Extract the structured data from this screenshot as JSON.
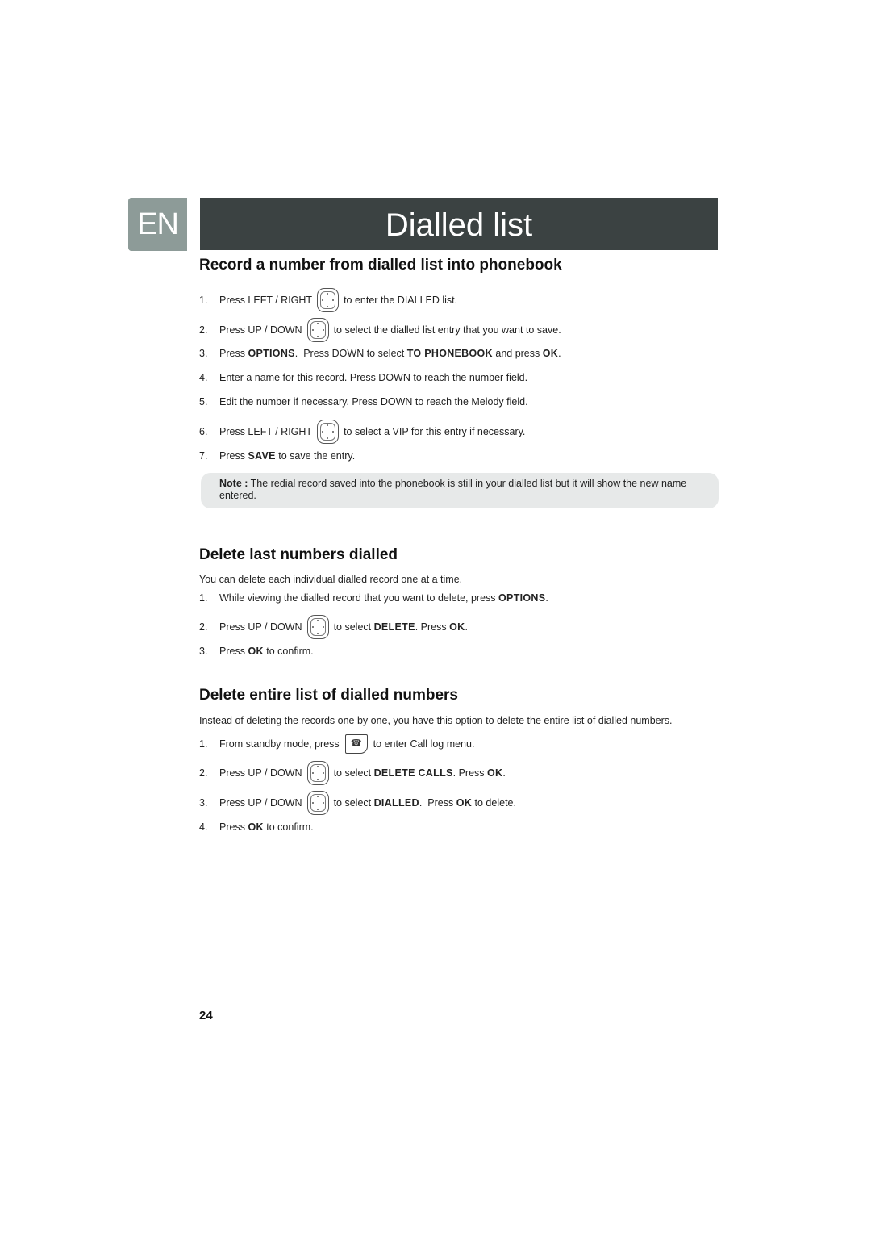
{
  "header": {
    "language": "EN",
    "title": "Dialled list"
  },
  "section1": {
    "heading": "Record a number from dialled list into phonebook",
    "steps": [
      {
        "num": "1.",
        "pre": "Press LEFT / RIGHT",
        "icon": "nav-key-icon",
        "post": "to enter the DIALLED list."
      },
      {
        "num": "2.",
        "pre": "Press UP / DOWN",
        "icon": "nav-key-icon",
        "post": "to select the dialled list entry that you want to save."
      },
      {
        "num": "3.",
        "parts": [
          "Press ",
          "OPTIONS",
          ".  Press DOWN to select ",
          "TO PHONEBOOK",
          " and press ",
          "OK",
          "."
        ]
      },
      {
        "num": "4.",
        "text": "Enter a name for this record. Press DOWN to reach the number field."
      },
      {
        "num": "5.",
        "text": "Edit the number if necessary. Press DOWN to reach the Melody field."
      },
      {
        "num": "6.",
        "pre": "Press LEFT / RIGHT",
        "icon": "nav-key-icon",
        "post": "to select a VIP for this entry if necessary."
      },
      {
        "num": "7.",
        "parts": [
          "Press ",
          "SAVE",
          " to save the entry."
        ]
      }
    ],
    "note": {
      "label": "Note :",
      "text": " The redial record saved into the phonebook is still in your dialled list but it will show the new name entered."
    }
  },
  "section2": {
    "heading": "Delete last numbers dialled",
    "intro": "You can delete each individual dialled record one at a time.",
    "steps": [
      {
        "num": "1.",
        "parts": [
          "While viewing the dialled record that you want to delete, press ",
          "OPTIONS",
          "."
        ]
      },
      {
        "num": "2.",
        "pre": "Press UP / DOWN",
        "icon": "nav-key-icon",
        "parts": [
          "to select ",
          "DELETE",
          ". Press ",
          "OK",
          "."
        ]
      },
      {
        "num": "3.",
        "parts": [
          "Press ",
          "OK",
          " to confirm."
        ]
      }
    ]
  },
  "section3": {
    "heading": "Delete entire list of dialled numbers",
    "intro": "Instead of deleting the records one by one, you have this option to delete the entire list of dialled numbers.",
    "steps": [
      {
        "num": "1.",
        "pre": "From standby mode, press",
        "icon": "call-log-key-icon",
        "icon_glyph": "☎",
        "post": "to enter Call log menu."
      },
      {
        "num": "2.",
        "pre": "Press UP / DOWN",
        "icon": "nav-key-icon",
        "parts": [
          "to select ",
          "DELETE CALLS",
          ". Press ",
          "OK",
          "."
        ]
      },
      {
        "num": "3.",
        "pre": "Press UP / DOWN",
        "icon": "nav-key-icon",
        "parts": [
          "to select ",
          "DIALLED",
          ".  Press ",
          "OK",
          " to delete."
        ]
      },
      {
        "num": "4.",
        "parts": [
          "Press ",
          "OK",
          " to confirm."
        ]
      }
    ]
  },
  "footer": {
    "page_number": "24"
  }
}
